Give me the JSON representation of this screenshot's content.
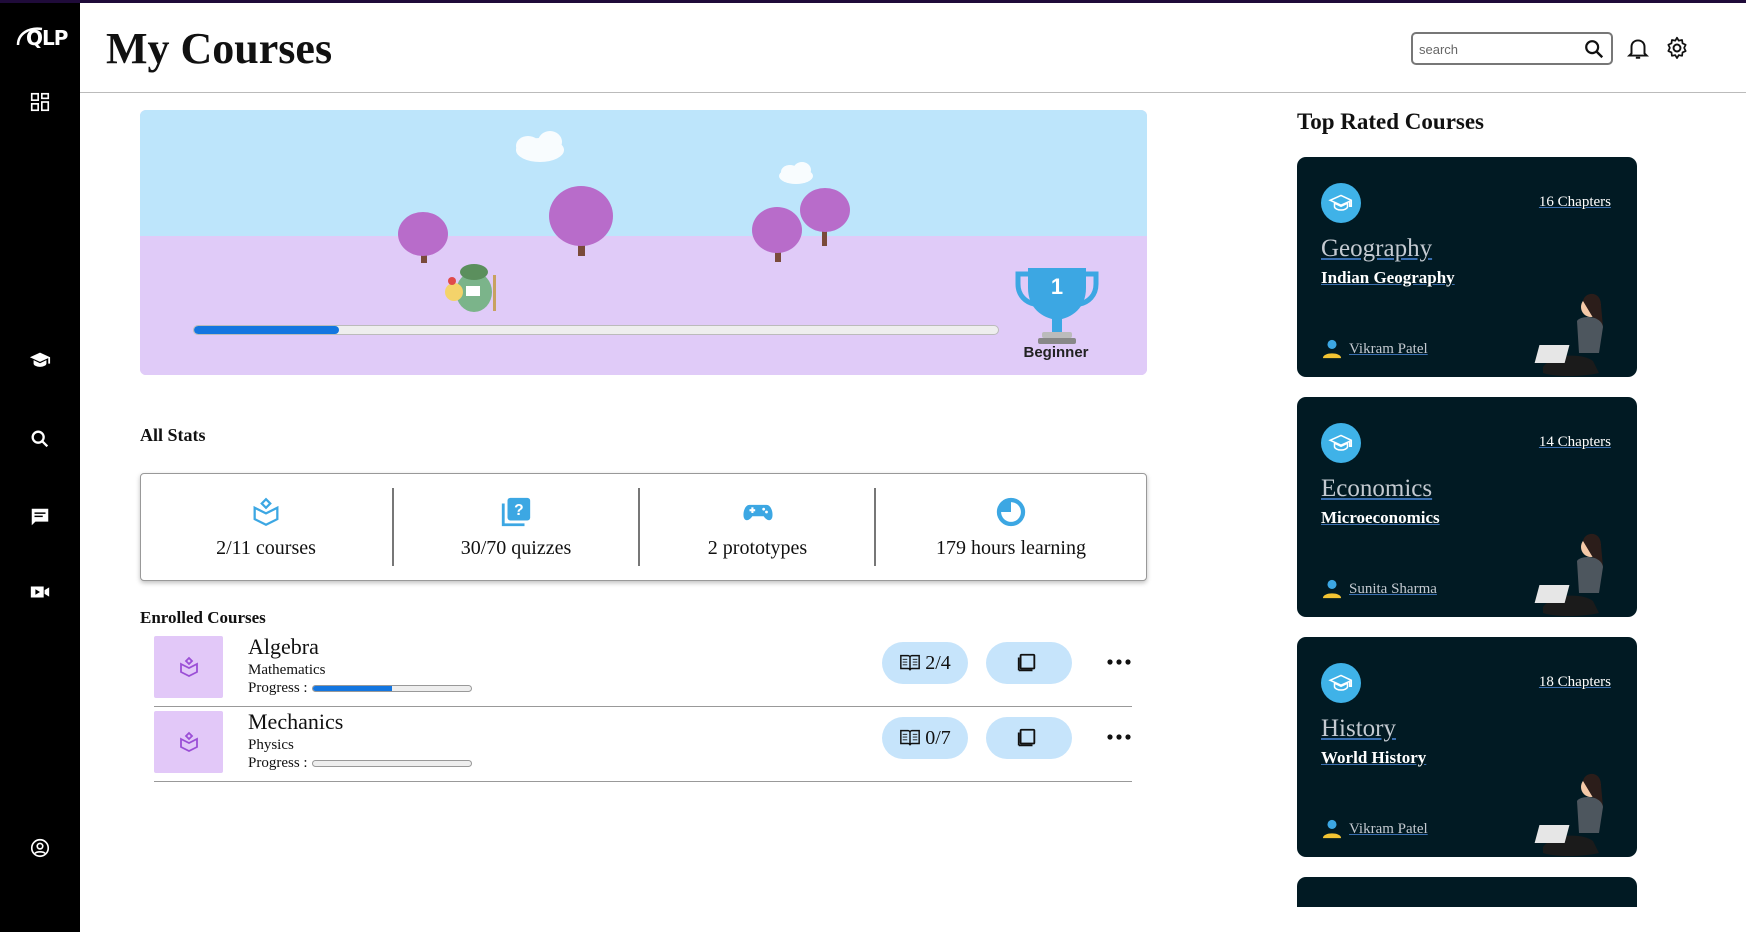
{
  "app": {
    "logo_text": "QLP",
    "title": "My Courses"
  },
  "sidebar": {
    "items": [
      {
        "name": "dashboard",
        "icon": "dashboard-icon"
      },
      {
        "name": "courses",
        "icon": "graduation-cap-icon"
      },
      {
        "name": "search",
        "icon": "search-icon"
      },
      {
        "name": "chat",
        "icon": "chat-icon"
      },
      {
        "name": "video",
        "icon": "video-icon"
      },
      {
        "name": "profile",
        "icon": "account-icon"
      }
    ]
  },
  "header": {
    "search_placeholder": "search"
  },
  "hero": {
    "progress": 0.18,
    "level_number": "1",
    "level_label": "Beginner"
  },
  "stats": {
    "title": "All Stats",
    "items": [
      {
        "text": "2/11 courses",
        "icon": "book-open-icon"
      },
      {
        "text": "30/70 quizzes",
        "icon": "quiz-icon"
      },
      {
        "text": "2 prototypes",
        "icon": "gamepad-icon"
      },
      {
        "text": "179 hours learning",
        "icon": "clock-icon"
      }
    ]
  },
  "enrolled": {
    "title": "Enrolled Courses",
    "progress_label": "Progress :",
    "courses": [
      {
        "name": "Algebra",
        "subject": "Mathematics",
        "progress": 0.5,
        "chapters": "2/4"
      },
      {
        "name": "Mechanics",
        "subject": "Physics",
        "progress": 0,
        "chapters": "0/7"
      }
    ]
  },
  "top_rated": {
    "title": "Top Rated Courses",
    "cards": [
      {
        "chapters": "16 Chapters",
        "title": "Geography",
        "subtitle": "Indian Geography",
        "author": "Vikram Patel"
      },
      {
        "chapters": "14 Chapters",
        "title": "Economics",
        "subtitle": "Microeconomics",
        "author": "Sunita Sharma"
      },
      {
        "chapters": "18 Chapters",
        "title": "History",
        "subtitle": "World History",
        "author": "Vikram Patel"
      }
    ]
  },
  "colors": {
    "accent": "#1476e0",
    "card_bg": "#011a23",
    "sky": "#bde5fb",
    "ground": "#e0cbf8",
    "pill": "#c6e4fb"
  }
}
